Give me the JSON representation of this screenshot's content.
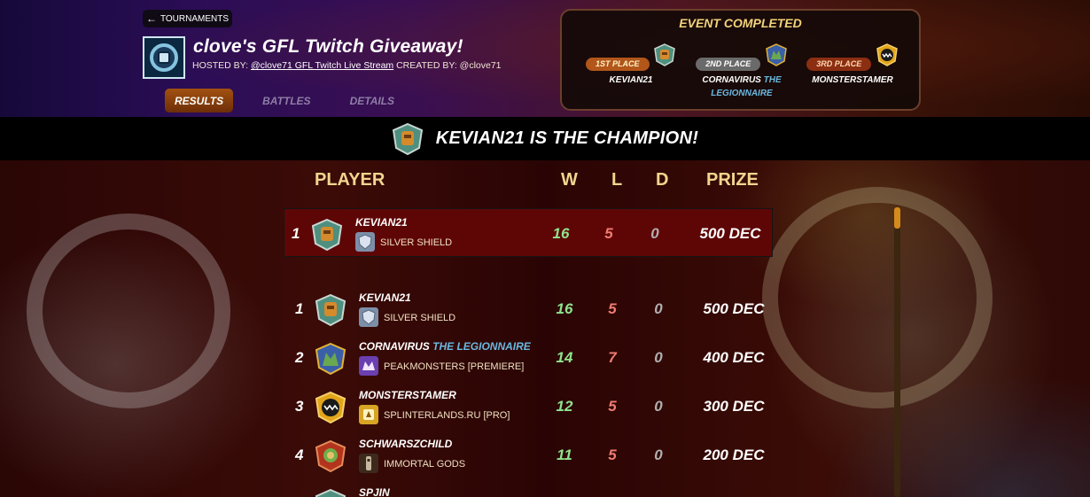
{
  "nav": {
    "back_label": "TOURNAMENTS"
  },
  "tournament": {
    "title": "clove's GFL Twitch Giveaway!",
    "hosted_by_label": "HOSTED BY:",
    "hosted_by": "@clove71 GFL Twitch Live Stream",
    "created_by_label": "CREATED BY:",
    "created_by": "@clove71"
  },
  "tabs": [
    {
      "label": "RESULTS",
      "active": true
    },
    {
      "label": "BATTLES",
      "active": false
    },
    {
      "label": "DETAILS",
      "active": false
    }
  ],
  "event": {
    "title": "EVENT COMPLETED",
    "places": [
      {
        "place": "1ST PLACE",
        "name": "KEVIAN21",
        "guild": ""
      },
      {
        "place": "2ND PLACE",
        "name": "CORNAVIRUS",
        "guild": "THE LEGIONNAIRE"
      },
      {
        "place": "3RD PLACE",
        "name": "MONSTERSTAMER",
        "guild": ""
      }
    ]
  },
  "banner": {
    "text": "KEVIAN21 IS THE CHAMPION!"
  },
  "table": {
    "headers": {
      "player": "PLAYER",
      "w": "W",
      "l": "L",
      "d": "D",
      "prize": "PRIZE"
    },
    "highlight": {
      "rank": "1",
      "name": "KEVIAN21",
      "guild_title": "",
      "league": "SILVER SHIELD",
      "w": "16",
      "l": "5",
      "d": "0",
      "prize": "500 DEC"
    },
    "rows": [
      {
        "rank": "1",
        "name": "KEVIAN21",
        "guild_title": "",
        "league": "SILVER SHIELD",
        "w": "16",
        "l": "5",
        "d": "0",
        "prize": "500 DEC"
      },
      {
        "rank": "2",
        "name": "CORNAVIRUS",
        "guild_title": "THE LEGIONNAIRE",
        "league": "PEAKMONSTERS [PREMIERE]",
        "w": "14",
        "l": "7",
        "d": "0",
        "prize": "400 DEC"
      },
      {
        "rank": "3",
        "name": "MONSTERSTAMER",
        "guild_title": "",
        "league": "SPLINTERLANDS.RU [PRO]",
        "w": "12",
        "l": "5",
        "d": "0",
        "prize": "300 DEC"
      },
      {
        "rank": "4",
        "name": "SCHWARSZCHILD",
        "guild_title": "",
        "league": "IMMORTAL GODS",
        "w": "11",
        "l": "5",
        "d": "0",
        "prize": "200 DEC"
      },
      {
        "rank": "",
        "name": "SPJIN",
        "guild_title": "",
        "league": "",
        "w": "",
        "l": "",
        "d": "",
        "prize": ""
      }
    ]
  },
  "icons": {
    "back": "arrow-left-icon",
    "tournament_logo": "tournament-logo-icon",
    "avatars": [
      "knight-avatar-icon",
      "dragon-avatar-icon",
      "monster-avatar-icon",
      "elf-avatar-icon"
    ]
  },
  "colors": {
    "win": "#8fe38d",
    "loss": "#f07c72",
    "draw": "#b0b0b0",
    "header_gold": "#f1d58e",
    "guild_blue": "#6bb8e0",
    "active_tab": "#a25111"
  }
}
